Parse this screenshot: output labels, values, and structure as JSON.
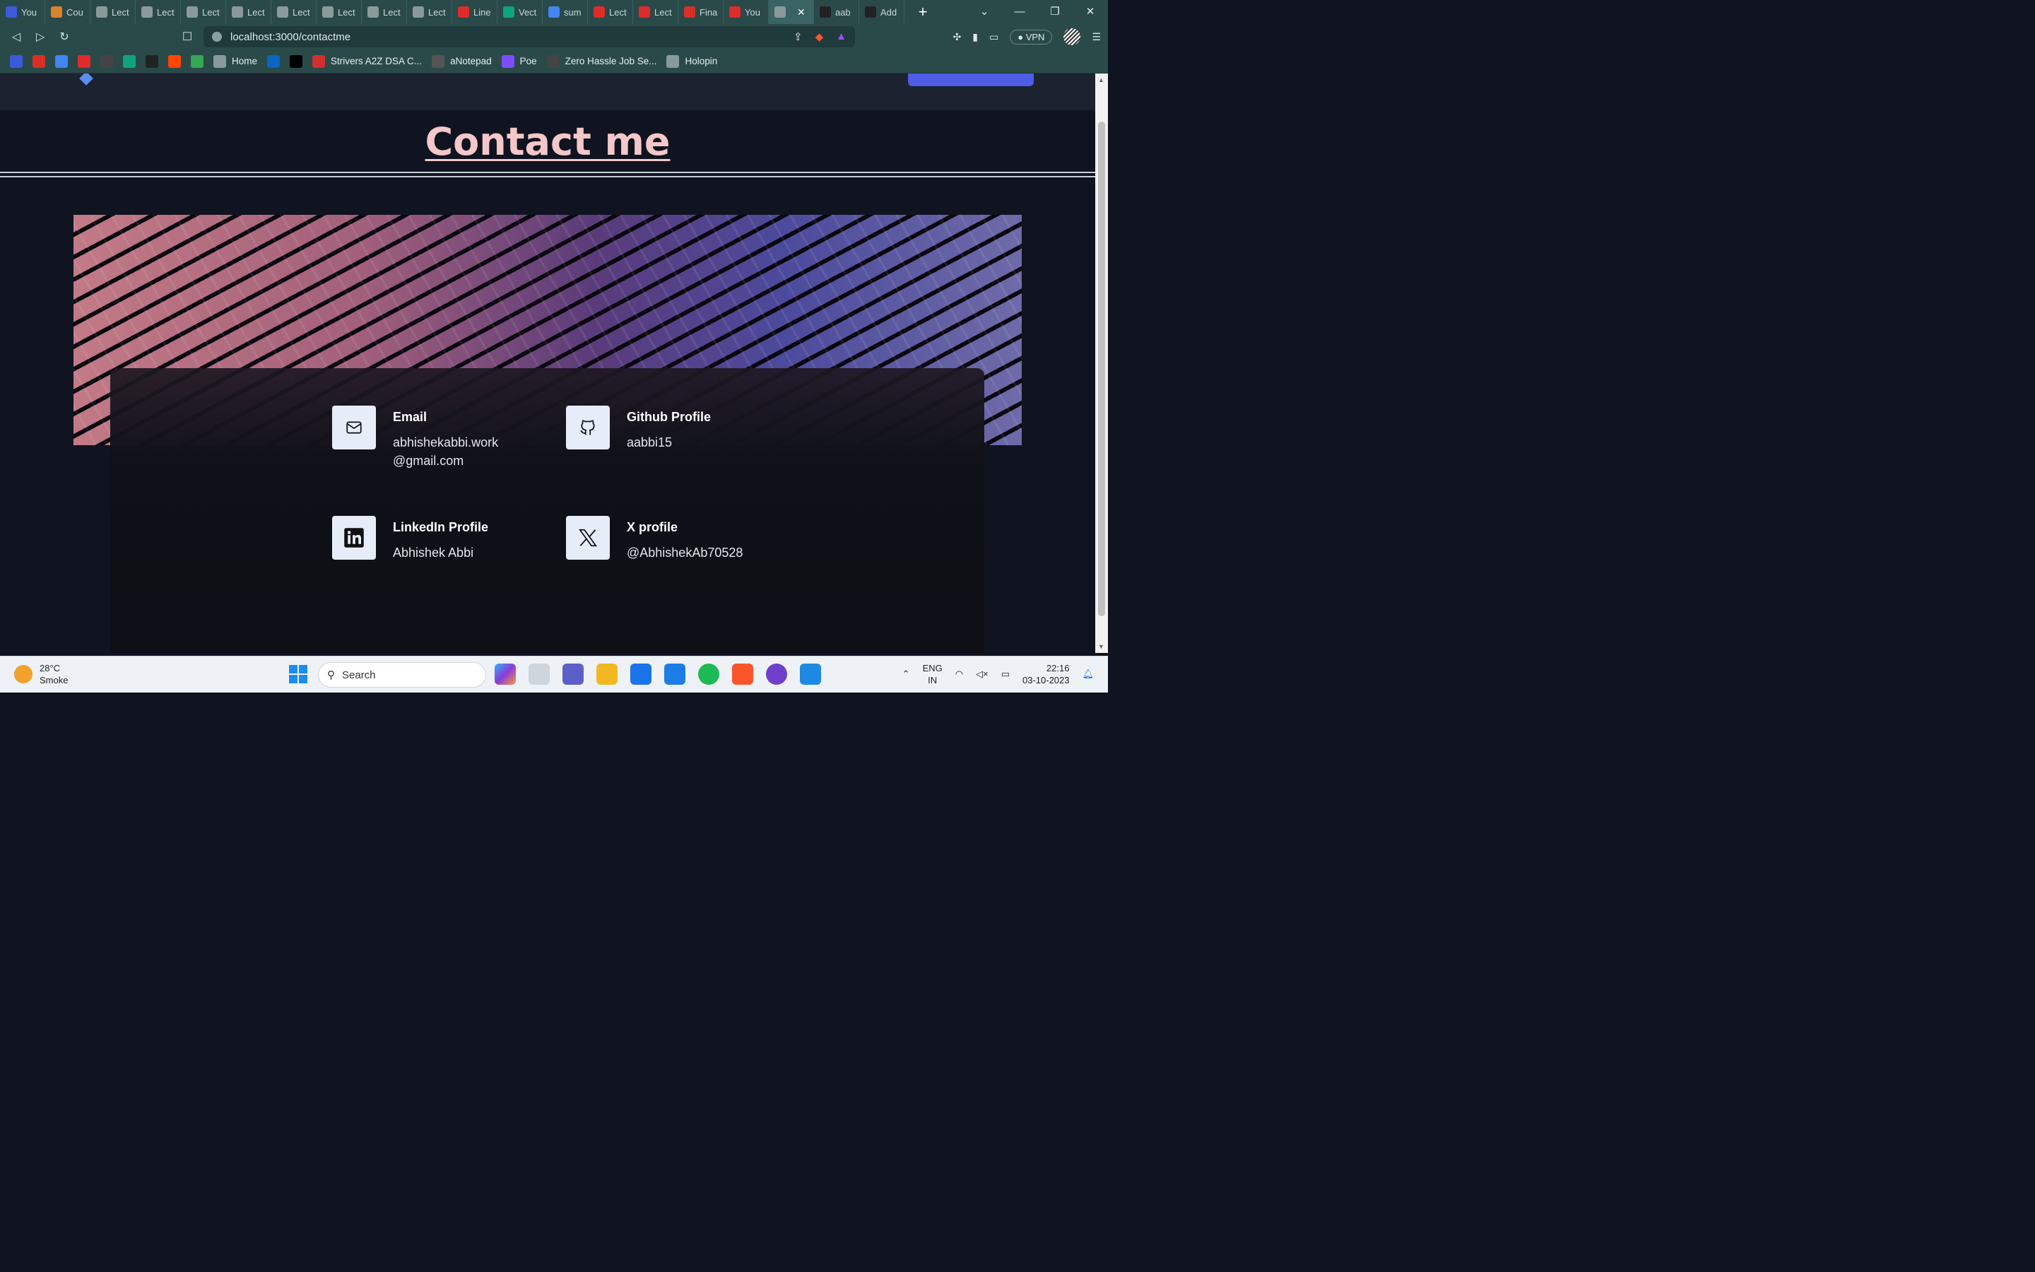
{
  "browser": {
    "tabs": [
      {
        "label": "You",
        "favicon": "S",
        "color": "#3b5bdb"
      },
      {
        "label": "Cou",
        "favicon": "in",
        "color": "#d9822b"
      },
      {
        "label": "Lect",
        "favicon": "globe",
        "color": "#8a9a9a"
      },
      {
        "label": "Lect",
        "favicon": "globe",
        "color": "#8a9a9a"
      },
      {
        "label": "Lect",
        "favicon": "globe",
        "color": "#8a9a9a"
      },
      {
        "label": "Lect",
        "favicon": "globe",
        "color": "#8a9a9a"
      },
      {
        "label": "Lect",
        "favicon": "globe",
        "color": "#8a9a9a"
      },
      {
        "label": "Lect",
        "favicon": "globe",
        "color": "#8a9a9a"
      },
      {
        "label": "Lect",
        "favicon": "globe",
        "color": "#8a9a9a"
      },
      {
        "label": "Lect",
        "favicon": "globe",
        "color": "#8a9a9a"
      },
      {
        "label": "Line",
        "favicon": "yt",
        "color": "#e02b2b"
      },
      {
        "label": "Vect",
        "favicon": "gpt",
        "color": "#10a37f"
      },
      {
        "label": "sum",
        "favicon": "G",
        "color": "#4285f4"
      },
      {
        "label": "Lect",
        "favicon": "yt",
        "color": "#e02b2b"
      },
      {
        "label": "Lect",
        "favicon": "yt",
        "color": "#e02b2b"
      },
      {
        "label": "Fina",
        "favicon": "M",
        "color": "#d93025"
      },
      {
        "label": "You",
        "favicon": "yt",
        "color": "#e02b2b"
      },
      {
        "label": "",
        "favicon": "globe",
        "color": "#8a9a9a",
        "active": true
      },
      {
        "label": "aab",
        "favicon": "gh",
        "color": "#222222"
      },
      {
        "label": "Add",
        "favicon": "gh",
        "color": "#222222"
      }
    ],
    "url": "localhost:3000/contactme",
    "vpn_label": "VPN",
    "bookmarks": [
      {
        "label": "",
        "icon": "S",
        "color": "#3b5bdb"
      },
      {
        "label": "",
        "icon": "M",
        "color": "#d93025"
      },
      {
        "label": "",
        "icon": "G",
        "color": "#4285f4"
      },
      {
        "label": "",
        "icon": "yt",
        "color": "#e02b2b"
      },
      {
        "label": "",
        "icon": "⚡",
        "color": "#444444"
      },
      {
        "label": "",
        "icon": "gpt",
        "color": "#10a37f"
      },
      {
        "label": "",
        "icon": "gh",
        "color": "#222222"
      },
      {
        "label": "",
        "icon": "r",
        "color": "#ff4500"
      },
      {
        "label": "",
        "icon": "cl",
        "color": "#34a853"
      },
      {
        "label": "Home",
        "icon": "globe",
        "color": "#8a9a9a"
      },
      {
        "label": "",
        "icon": "in",
        "color": "#0a66c2"
      },
      {
        "label": "",
        "icon": "X",
        "color": "#000000"
      },
      {
        "label": "Strivers A2Z DSA C...",
        "icon": "tuf",
        "color": "#d32f2f"
      },
      {
        "label": "aNotepad",
        "icon": "np",
        "color": "#555555"
      },
      {
        "label": "Poe",
        "icon": "poe",
        "color": "#7c4dff"
      },
      {
        "label": "Zero Hassle Job Se...",
        "icon": "ih",
        "color": "#444444"
      },
      {
        "label": "Holopin",
        "icon": "globe",
        "color": "#8a9a9a"
      }
    ]
  },
  "page": {
    "heading": "Contact me",
    "contacts": [
      {
        "label": "Email",
        "value": "abhishekabbi.work\n@gmail.com",
        "icon": "mail-icon"
      },
      {
        "label": "Github Profile",
        "value": "aabbi15",
        "icon": "github-icon"
      },
      {
        "label": "LinkedIn Profile",
        "value": "Abhishek Abbi",
        "icon": "linkedin-icon"
      },
      {
        "label": "X profile",
        "value": "@AbhishekAb70528",
        "icon": "x-icon"
      }
    ]
  },
  "taskbar": {
    "weather_temp": "28°C",
    "weather_desc": "Smoke",
    "search_label": "Search",
    "lang_line1": "ENG",
    "lang_line2": "IN",
    "time": "22:16",
    "date": "03-10-2023"
  }
}
